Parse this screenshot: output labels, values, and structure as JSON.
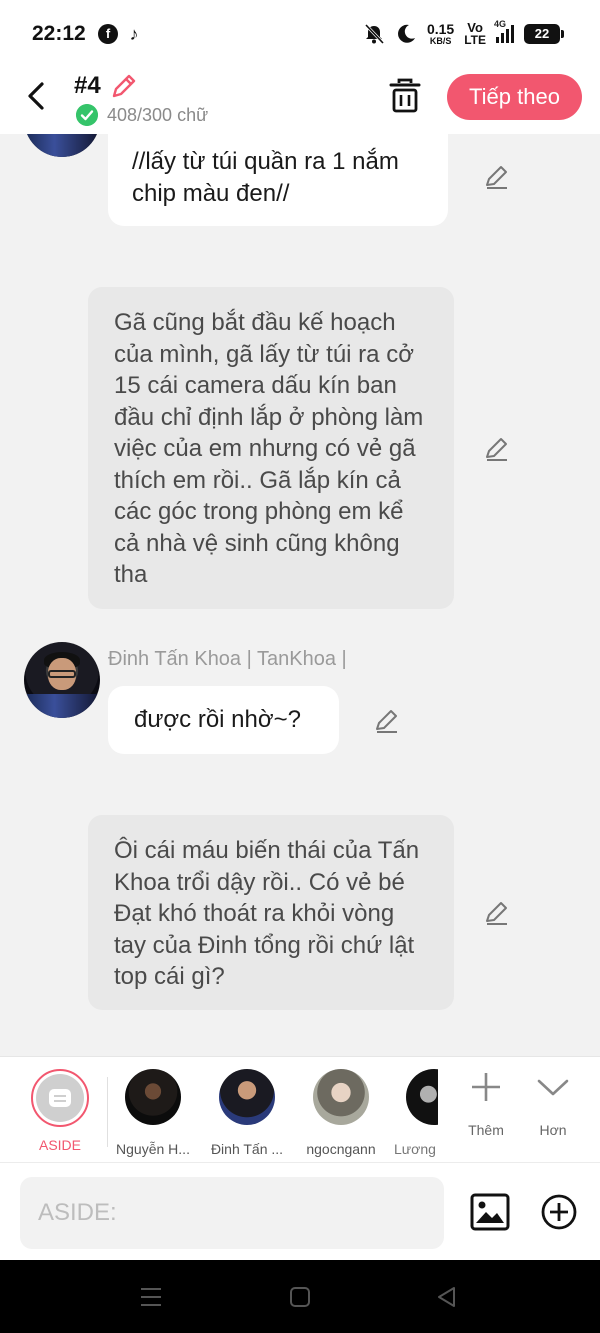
{
  "status_bar": {
    "time": "22:12",
    "apps": [
      "facebook-icon",
      "tiktok-icon"
    ],
    "net_speed": "0.15",
    "net_unit": "KB/S",
    "volte_top": "Vo",
    "volte_bottom": "LTE",
    "signal_label": "4G",
    "battery": "22"
  },
  "header": {
    "chapter": "#4",
    "word_count": "408/300 chữ",
    "next_label": "Tiếp theo"
  },
  "messages": [
    {
      "type": "dialogue",
      "text": "//lấy từ túi quần ra 1 nắm chip màu đen//"
    },
    {
      "type": "narration",
      "text": "Gã cũng bắt đầu kế hoạch của mình, gã lấy từ túi ra cở 15 cái camera dấu kín ban đầu chỉ định lắp ở phòng làm việc của em nhưng có vẻ gã thích em rồi.. Gã lắp kín cả các góc trong phòng em kể cả nhà vệ sinh cũng không tha"
    },
    {
      "type": "dialogue",
      "speaker": "Đinh Tấn Khoa | TanKhoa |",
      "text": "được rồi nhờ~?"
    },
    {
      "type": "narration",
      "text": "Ôi cái máu biến thái của Tấn Khoa trổi dậy rồi.. Có vẻ bé Đạt khó thoát ra khỏi vòng tay của Đinh tổng rồi chứ lật top cái gì?"
    }
  ],
  "characters": [
    {
      "label": "ASIDE"
    },
    {
      "label": "Nguyễn H..."
    },
    {
      "label": "Đinh Tấn ..."
    },
    {
      "label": "ngocngann"
    },
    {
      "label": "Lương"
    }
  ],
  "tools": {
    "add_label": "Thêm",
    "more_label": "Hơn"
  },
  "input": {
    "placeholder": "ASIDE:"
  },
  "colors": {
    "accent": "#f2576f",
    "check": "#35c46a",
    "bubble_gray": "#e8e8e8"
  }
}
